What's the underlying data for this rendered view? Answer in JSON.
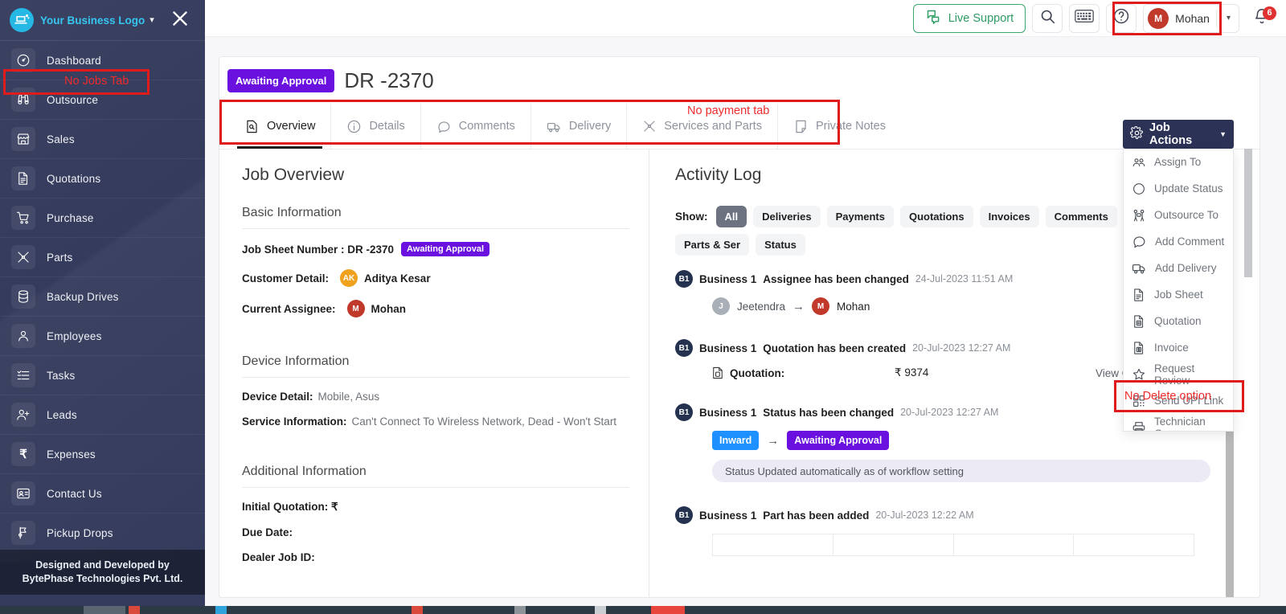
{
  "sidebar": {
    "brand": "Your Business Logo",
    "items": [
      {
        "label": "Dashboard",
        "icon": "speedometer-icon"
      },
      {
        "label": "Outsource",
        "icon": "binoculars-icon"
      },
      {
        "label": "Sales",
        "icon": "storefront-icon"
      },
      {
        "label": "Quotations",
        "icon": "document-icon"
      },
      {
        "label": "Purchase",
        "icon": "shopping-cart-icon"
      },
      {
        "label": "Parts",
        "icon": "tools-icon"
      },
      {
        "label": "Backup Drives",
        "icon": "database-icon"
      },
      {
        "label": "Employees",
        "icon": "person-icon"
      },
      {
        "label": "Tasks",
        "icon": "task-list-icon"
      },
      {
        "label": "Leads",
        "icon": "person-add-icon"
      },
      {
        "label": "Expenses",
        "icon": "rupee-icon"
      },
      {
        "label": "Contact Us",
        "icon": "contact-card-icon"
      },
      {
        "label": "Pickup Drops",
        "icon": "flag-pin-icon"
      }
    ],
    "footer": "Designed and Developed by BytePhase Technologies Pvt. Ltd."
  },
  "topbar": {
    "live_support": "Live Support",
    "search_icon": "search-icon",
    "keyboard_icon": "keyboard-icon",
    "help_icon": "help-circle-icon",
    "user_initial": "M",
    "user_name": "Mohan",
    "bell_icon": "bell-icon",
    "notification_count": "6"
  },
  "job": {
    "status_badge": "Awaiting Approval",
    "title": "DR -2370",
    "tabs": [
      {
        "label": "Overview",
        "icon": "overview-doc-icon",
        "active": true
      },
      {
        "label": "Details",
        "icon": "info-circle-icon",
        "active": false
      },
      {
        "label": "Comments",
        "icon": "comment-bubble-icon",
        "active": false
      },
      {
        "label": "Delivery",
        "icon": "truck-icon",
        "active": false
      },
      {
        "label": "Services and Parts",
        "icon": "tools-icon",
        "active": false
      },
      {
        "label": "Private Notes",
        "icon": "note-icon",
        "active": false
      }
    ]
  },
  "overview": {
    "heading": "Job Overview",
    "basic_heading": "Basic Information",
    "job_sheet_label": "Job Sheet Number : DR -2370",
    "job_sheet_badge": "Awaiting Approval",
    "customer_label": "Customer Detail:",
    "customer_initials": "AK",
    "customer_name": "Aditya Kesar",
    "assignee_label": "Current Assignee:",
    "assignee_initials": "M",
    "assignee_name": "Mohan",
    "device_heading": "Device Information",
    "device_label": "Device Detail:",
    "device_value": "Mobile, Asus",
    "service_label": "Service Information:",
    "service_value": "Can't Connect To Wireless Network, Dead - Won't Start",
    "additional_heading": "Additional Information",
    "initial_quotation_label": "Initial Quotation: ₹",
    "due_date_label": "Due Date:",
    "dealer_job_id_label": "Dealer Job ID:"
  },
  "activity": {
    "heading": "Activity Log",
    "show_label": "Show:",
    "filters": [
      {
        "label": "All",
        "selected": true
      },
      {
        "label": "Deliveries",
        "selected": false
      },
      {
        "label": "Payments",
        "selected": false
      },
      {
        "label": "Quotations",
        "selected": false
      },
      {
        "label": "Invoices",
        "selected": false
      },
      {
        "label": "Comments",
        "selected": false
      },
      {
        "label": "Parts & Ser",
        "selected": false
      },
      {
        "label": "Status",
        "selected": false
      }
    ],
    "events": [
      {
        "biz": "B1",
        "who": "Business 1",
        "action": "Assignee has been changed",
        "time": "24-Jul-2023 11:51 AM",
        "from_initial": "J",
        "from_name": "Jeetendra",
        "to_initial": "M",
        "to_name": "Mohan"
      },
      {
        "biz": "B1",
        "who": "Business 1",
        "action": "Quotation has been created",
        "time": "20-Jul-2023 12:27 AM",
        "q_label": "Quotation:",
        "q_amount": "₹ 9374",
        "q_link": "View Quotation"
      },
      {
        "biz": "B1",
        "who": "Business 1",
        "action": "Status has been changed",
        "time": "20-Jul-2023 12:27 AM",
        "from_status": "Inward",
        "to_status": "Awaiting Approval",
        "note": "Status Updated automatically as of workflow setting"
      },
      {
        "biz": "B1",
        "who": "Business 1",
        "action": "Part has been added",
        "time": "20-Jul-2023 12:22 AM"
      }
    ]
  },
  "job_actions": {
    "button_label": "Job Actions",
    "gear_icon": "gear-icon",
    "items": [
      {
        "label": "Assign To",
        "icon": "people-icon"
      },
      {
        "label": "Update Status",
        "icon": "circle-icon"
      },
      {
        "label": "Outsource To",
        "icon": "outsource-people-icon"
      },
      {
        "label": "Add Comment",
        "icon": "comment-bubble-icon"
      },
      {
        "label": "Add Delivery",
        "icon": "truck-icon"
      },
      {
        "label": "Job Sheet",
        "icon": "document-icon"
      },
      {
        "label": "Quotation",
        "icon": "quote-doc-icon"
      },
      {
        "label": "Invoice",
        "icon": "invoice-doc-icon"
      },
      {
        "label": "Request Review",
        "icon": "star-icon"
      },
      {
        "label": "Send UPI Link",
        "icon": "qr-code-icon"
      },
      {
        "label": "Technician Copy",
        "icon": "printer-icon"
      }
    ]
  },
  "annotations": [
    {
      "text": "No Jobs Tab"
    },
    {
      "text": "No payment tab"
    },
    {
      "text": "No Delete option"
    }
  ]
}
